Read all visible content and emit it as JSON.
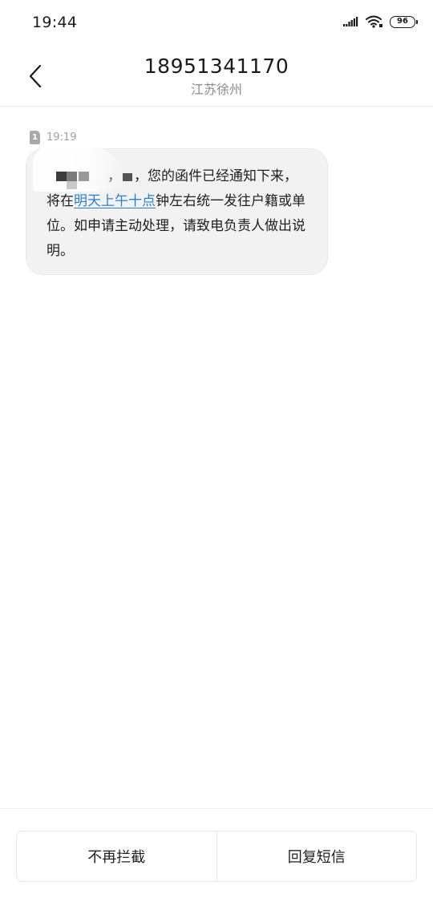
{
  "status_bar": {
    "time": "19:44",
    "battery_level": "96",
    "icons": [
      "signal-icon",
      "wifi-icon",
      "battery-icon"
    ]
  },
  "header": {
    "phone_number": "18951341170",
    "location": "江苏徐州",
    "back_icon": "chevron-left-icon"
  },
  "message": {
    "sim_slot": "1",
    "time": "19:19",
    "text_part1": "，",
    "text_part2": "，您的函件已经通知下来，将在",
    "link_text": "明天上午十点",
    "text_part3": "钟左右统一发往户籍或单位。如申请主动处理，请致电负责人做出说明。"
  },
  "actions": {
    "unblock_label": "不再拦截",
    "reply_label": "回复短信"
  },
  "colors": {
    "link": "#2b7fd0",
    "bubble_bg": "#f2f2f2",
    "secondary_text": "#8c8c8c"
  }
}
